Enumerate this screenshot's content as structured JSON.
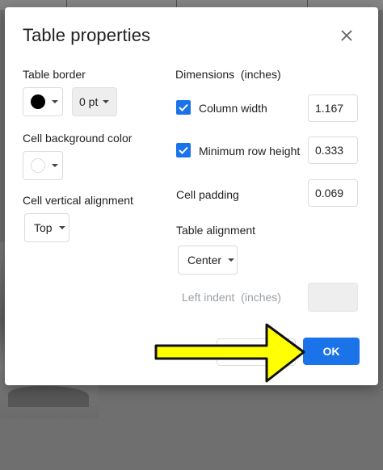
{
  "dialog": {
    "title": "Table properties",
    "close_icon": "close-icon"
  },
  "left": {
    "table_border_label": "Table border",
    "border_color": "#000000",
    "border_width": "0 pt",
    "cell_bg_label": "Cell background color",
    "cell_bg_color": "#ffffff",
    "vertical_alignment_label": "Cell vertical alignment",
    "vertical_alignment_value": "Top"
  },
  "right": {
    "dimensions_label": "Dimensions  (inches)",
    "column_width_label": "Column width",
    "column_width_checked": true,
    "column_width_value": "1.167",
    "min_row_height_label": "Minimum row height",
    "min_row_height_checked": true,
    "min_row_height_value": "0.333",
    "cell_padding_label": "Cell padding",
    "cell_padding_value": "0.069",
    "table_alignment_label": "Table alignment",
    "table_alignment_value": "Center",
    "left_indent_label": "Left indent  (inches)",
    "left_indent_value": ""
  },
  "footer": {
    "cancel_label": "",
    "ok_label": "OK"
  },
  "colors": {
    "accent": "#1a73e8",
    "annotation_arrow": "#ffff00"
  }
}
